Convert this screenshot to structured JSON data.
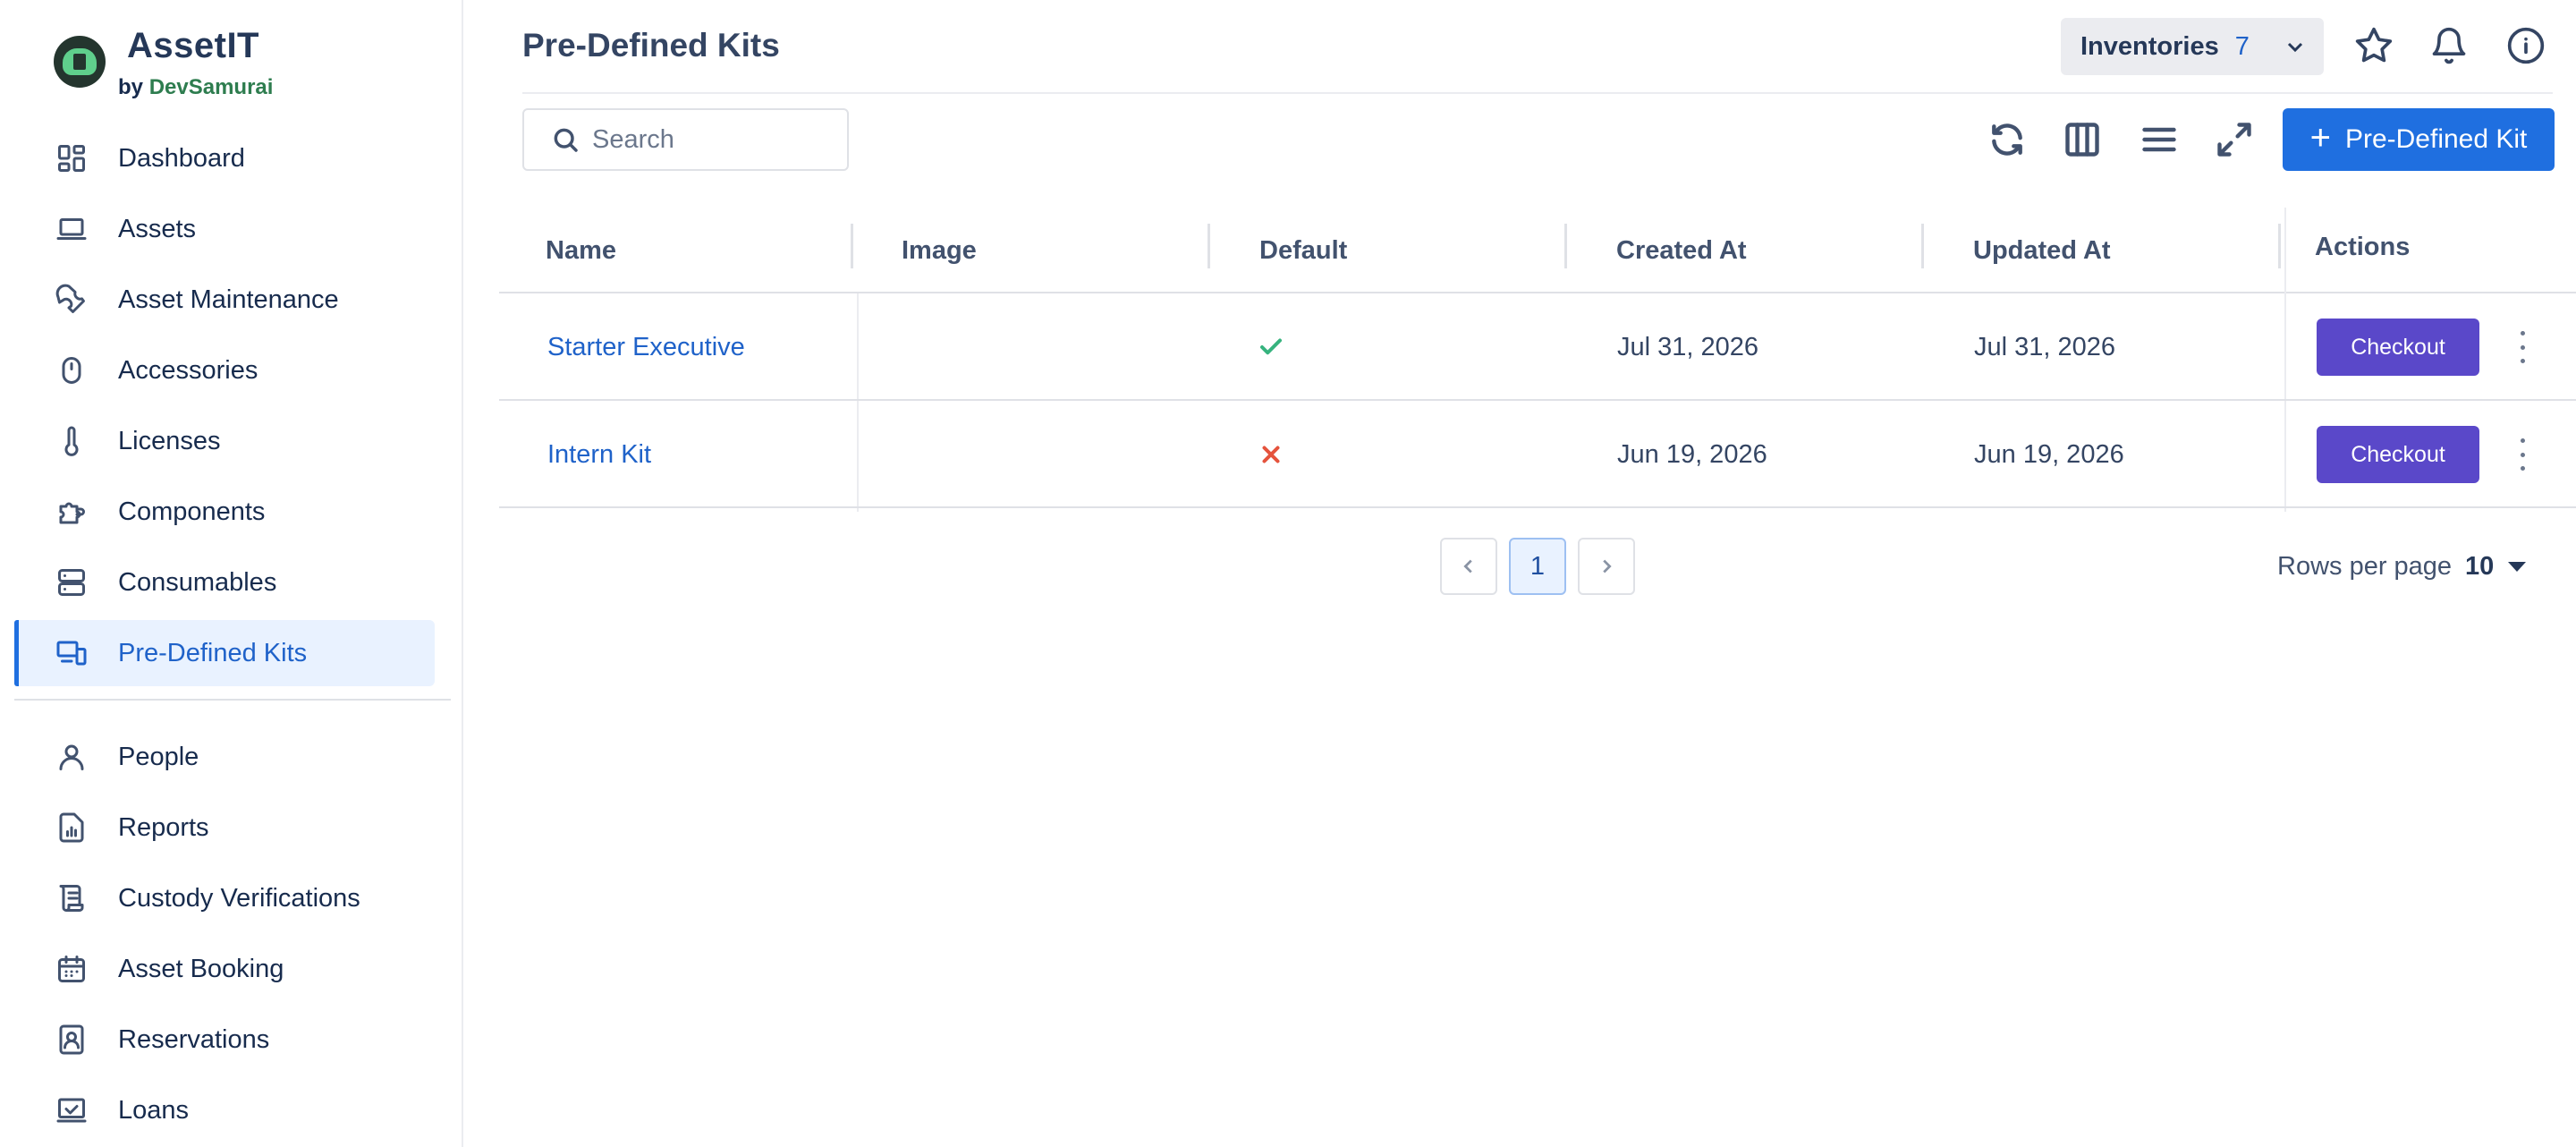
{
  "brand": {
    "name": "AssetIT",
    "by": "by",
    "company": "DevSamurai"
  },
  "sidebar": {
    "items": [
      {
        "label": "Dashboard",
        "icon": "dashboard-icon"
      },
      {
        "label": "Assets",
        "icon": "laptop-icon"
      },
      {
        "label": "Asset Maintenance",
        "icon": "wrench-icon"
      },
      {
        "label": "Accessories",
        "icon": "mouse-icon"
      },
      {
        "label": "Licenses",
        "icon": "thermometer-icon"
      },
      {
        "label": "Components",
        "icon": "puzzle-icon"
      },
      {
        "label": "Consumables",
        "icon": "storage-icon"
      },
      {
        "label": "Pre-Defined Kits",
        "icon": "devices-icon",
        "active": true
      }
    ],
    "secondary_items": [
      {
        "label": "People",
        "icon": "person-icon"
      },
      {
        "label": "Reports",
        "icon": "report-icon"
      },
      {
        "label": "Custody Verifications",
        "icon": "scroll-icon"
      },
      {
        "label": "Asset Booking",
        "icon": "calendar-icon"
      },
      {
        "label": "Reservations",
        "icon": "contact-book-icon"
      },
      {
        "label": "Loans",
        "icon": "monitor-check-icon"
      }
    ]
  },
  "header": {
    "title": "Pre-Defined Kits",
    "inventories_label": "Inventories",
    "inventories_count": "7"
  },
  "toolbar": {
    "search_placeholder": "Search",
    "add_button_label": "Pre-Defined Kit"
  },
  "table": {
    "columns": [
      "Name",
      "Image",
      "Default",
      "Created At",
      "Updated At",
      "Actions"
    ],
    "rows": [
      {
        "name": "Starter Executive",
        "image": "",
        "default": true,
        "created_at": "Jul 31, 2026",
        "updated_at": "Jul 31, 2026",
        "action_label": "Checkout"
      },
      {
        "name": "Intern Kit",
        "image": "",
        "default": false,
        "created_at": "Jun 19, 2026",
        "updated_at": "Jun 19, 2026",
        "action_label": "Checkout"
      }
    ]
  },
  "pagination": {
    "current_page": "1",
    "rows_per_page_label": "Rows per page",
    "rows_per_page": "10"
  },
  "colors": {
    "primary": "#1f6fe0",
    "checkout": "#5a48c9",
    "check": "#36b37e",
    "cross": "#e5533d",
    "active_bg": "#e9f2ff"
  }
}
